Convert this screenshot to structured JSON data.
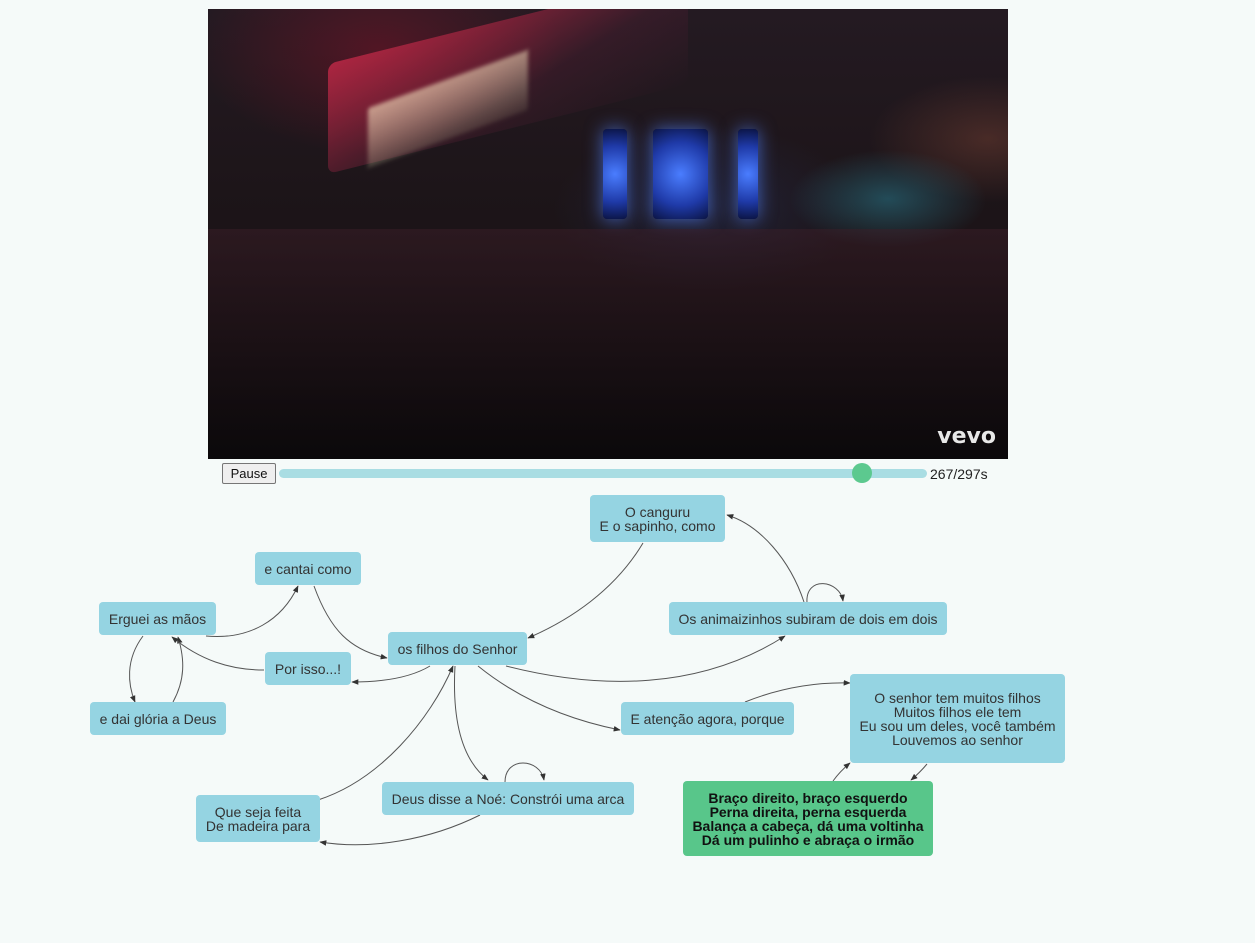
{
  "video": {
    "watermark": "vevo",
    "controls": {
      "pause_label": "Pause",
      "progress": 0.899,
      "time_readout": "267/297s"
    }
  },
  "graph": {
    "nodes": [
      {
        "id": "erguei",
        "lines": [
          "Erguei as mãos"
        ],
        "active": false
      },
      {
        "id": "cantai",
        "lines": [
          "e cantai como"
        ],
        "active": false
      },
      {
        "id": "filhos",
        "lines": [
          "os filhos do Senhor"
        ],
        "active": false
      },
      {
        "id": "gloria",
        "lines": [
          "e dai glória a Deus"
        ],
        "active": false
      },
      {
        "id": "porisso",
        "lines": [
          "Por isso...!"
        ],
        "active": false
      },
      {
        "id": "madeira",
        "lines": [
          "Que seja feita",
          "De madeira para"
        ],
        "active": false
      },
      {
        "id": "noe",
        "lines": [
          "Deus disse a Noé: Constrói uma arca"
        ],
        "active": false
      },
      {
        "id": "canguru",
        "lines": [
          "O canguru",
          "E o sapinho, como"
        ],
        "active": false
      },
      {
        "id": "animaizinhos",
        "lines": [
          "Os animaizinhos subiram de dois em dois"
        ],
        "active": false
      },
      {
        "id": "atencao",
        "lines": [
          "E atenção agora, porque"
        ],
        "active": false
      },
      {
        "id": "senhor",
        "lines": [
          "O senhor tem muitos filhos",
          "Muitos filhos ele tem",
          "Eu sou um deles, você também",
          "Louvemos ao senhor"
        ],
        "active": false
      },
      {
        "id": "braco",
        "lines": [
          "Braço direito, braço esquerdo",
          "Perna direita, perna esquerda",
          "Balança a cabeça, dá uma voltinha",
          "Dá um pulinho e abraça o irmão"
        ],
        "active": true
      }
    ]
  },
  "colors": {
    "node": "#95d4e2",
    "active_node": "#58c68a",
    "track": "#a9dde3",
    "knob": "#5cc98f",
    "edge": "#555555"
  }
}
